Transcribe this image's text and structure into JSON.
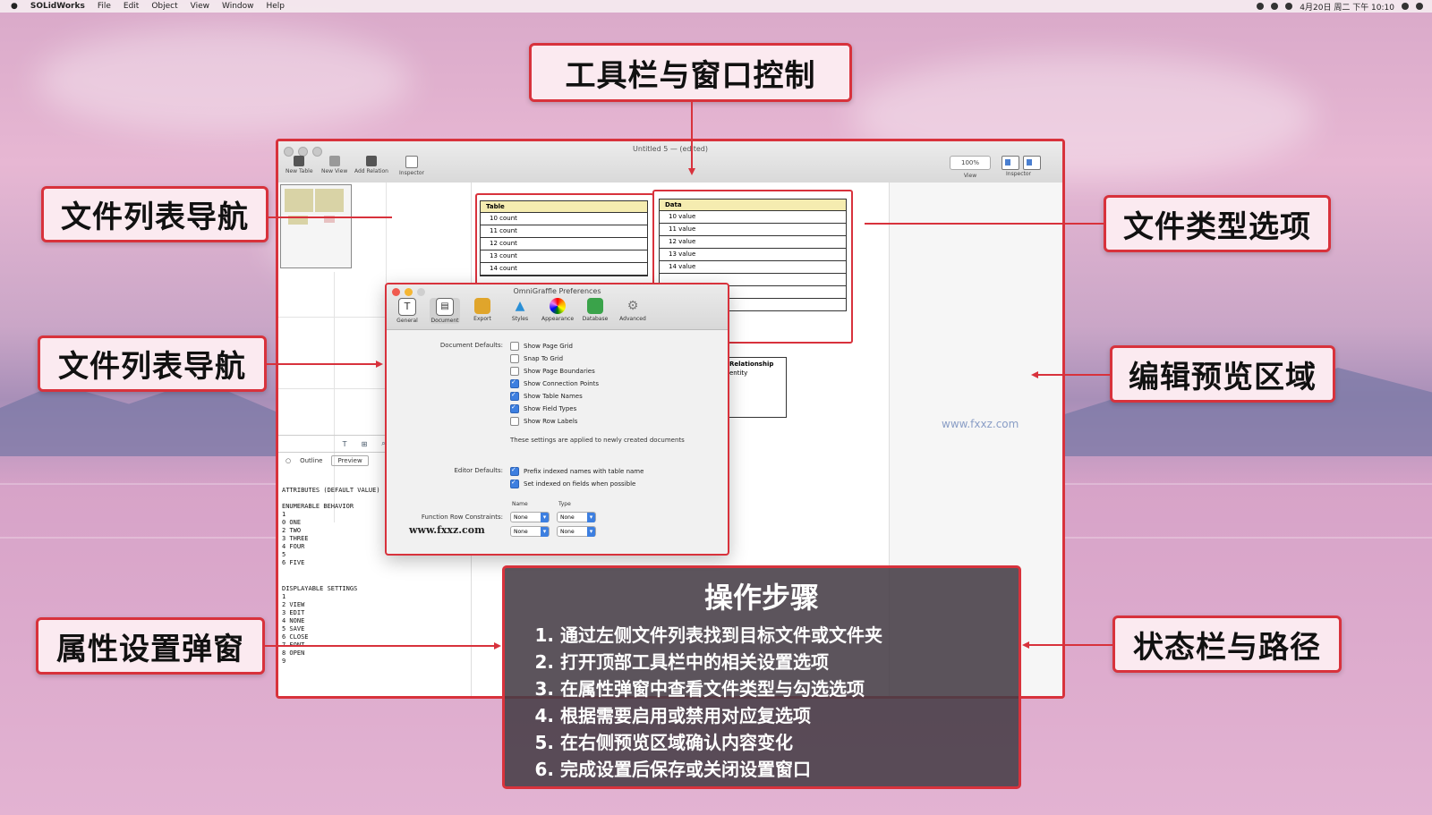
{
  "menubar": {
    "app": "SOLidWorks",
    "items": [
      "File",
      "Edit",
      "Object",
      "View",
      "Window",
      "Help"
    ],
    "clock": "4月20日 周二 下午 10:10"
  },
  "window": {
    "title": "Untitled 5 — (edited)",
    "toolbar": [
      "New Table",
      "New View",
      "Add Relation",
      "Inspector"
    ],
    "zoom": "100%",
    "view_label": "View",
    "inspector_label": "Inspector"
  },
  "sidebar": {
    "icons": [
      "T",
      "⊞",
      "⌕",
      "◫"
    ],
    "tabs": [
      "Outline",
      "Preview"
    ],
    "text_block1": "ATTRIBUTES (DEFAULT VALUE)\n\nENUMERABLE BEHAVIOR\n1\n0 ONE\n2 TWO\n3 THREE\n4 FOUR\n5\n6 FIVE",
    "text_block2": "DISPLAYABLE SETTINGS\n1\n2 VIEW\n3 EDIT\n4 NONE\n5 SAVE\n6 CLOSE\n7 FONT\n8 OPEN\n9"
  },
  "tables": {
    "left": {
      "header": "Table",
      "rows": [
        "10 count",
        "11 count",
        "12 count",
        "13 count",
        "14 count"
      ]
    },
    "right": {
      "header": "Data",
      "rows": [
        "10 value",
        "11 value",
        "12 value",
        "13 value",
        "14 value",
        "",
        "",
        ""
      ]
    },
    "node": {
      "title": "Relationship",
      "sub": "entity"
    }
  },
  "dialog": {
    "title": "OmniGraffle Preferences",
    "tabs": [
      "General",
      "Document",
      "Export",
      "Styles",
      "Appearance",
      "Database",
      "Advanced"
    ],
    "group1_label": "Document Defaults:",
    "group1_options": [
      {
        "label": "Show Page Grid",
        "checked": false
      },
      {
        "label": "Snap To Grid",
        "checked": false
      },
      {
        "label": "Show Page Boundaries",
        "checked": false
      },
      {
        "label": "Show Connection Points",
        "checked": true
      },
      {
        "label": "Show Table Names",
        "checked": true
      },
      {
        "label": "Show Field Types",
        "checked": true
      },
      {
        "label": "Show Row Labels",
        "checked": false
      }
    ],
    "group1_note": "These settings are applied to newly created documents",
    "group2_label": "Editor Defaults:",
    "group2_options": [
      {
        "label": "Prefix indexed names with table name",
        "checked": true
      },
      {
        "label": "Set indexed on fields when possible",
        "checked": true
      }
    ],
    "col_heads": [
      "Name",
      "Type"
    ],
    "group3_label": "Function Row Constraints:",
    "selects": [
      "None",
      "None",
      "None",
      "None"
    ],
    "watermark": "www.fxxz.com"
  },
  "watermark": "www.fxxz.com",
  "callouts": {
    "top": "工具栏与窗口控制",
    "left1": "文件列表导航",
    "left2": "文件列表导航",
    "left3": "属性设置弹窗",
    "right1": "文件类型选项",
    "right2": "编辑预览区域",
    "right3": "状态栏与路径"
  },
  "steps": {
    "title": "操作步骤",
    "items": [
      "通过左侧文件列表找到目标文件或文件夹",
      "打开顶部工具栏中的相关设置选项",
      "在属性弹窗中查看文件类型与勾选选项",
      "根据需要启用或禁用对应复选项",
      "在右侧预览区域确认内容变化",
      "完成设置后保存或关闭设置窗口"
    ]
  },
  "colors": {
    "accent": "#d8323c",
    "tableHeader": "#f5ecb0",
    "checkbox": "#3d7fe0"
  }
}
